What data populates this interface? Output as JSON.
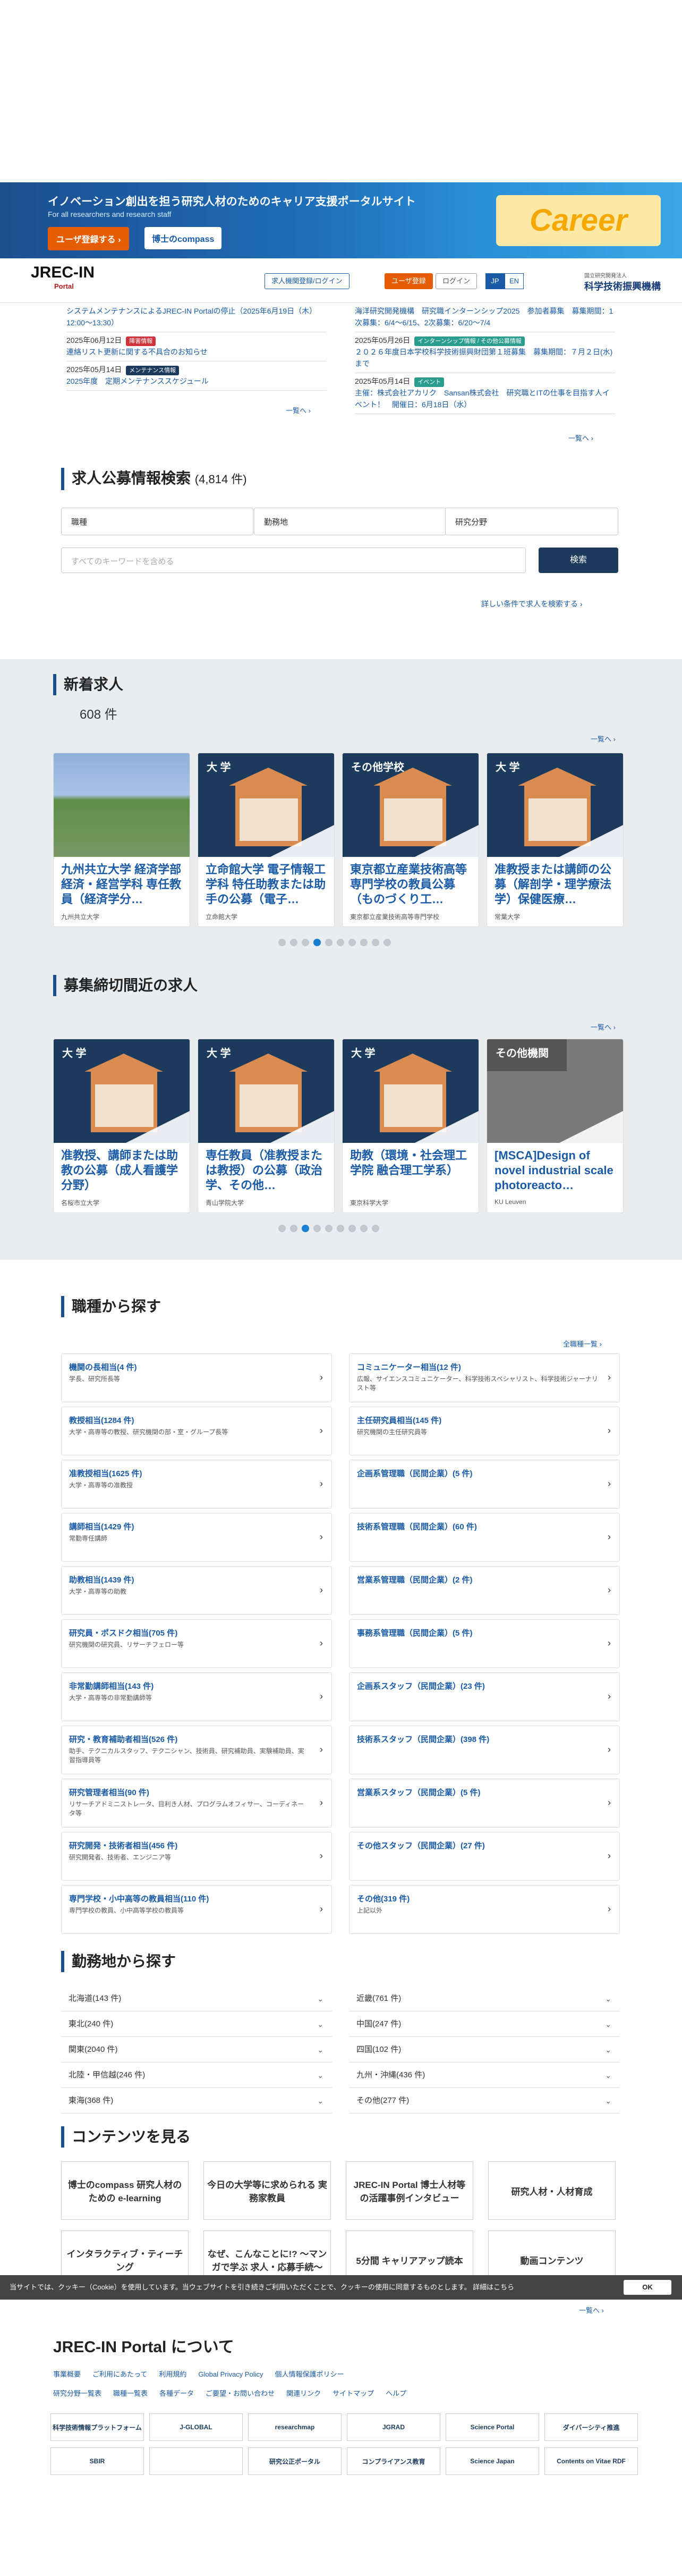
{
  "banner": {
    "title": "イノベーション創出を担う研究人材のためのキャリア支援ポータルサイト",
    "subtitle": "For all researchers and research staff",
    "register": "ユーザ登録する ›",
    "compass": "博士のcompass",
    "career": "Career"
  },
  "header": {
    "logo": "JREC-IN",
    "logo_sub": "Portal",
    "recruiter_btn": "求人機関登録/ログイン",
    "register_btn": "ユーザ登録",
    "login_btn": "ログイン",
    "lang_jp": "JP",
    "lang_en": "EN",
    "jst_name": "科学技術振興機構",
    "jst_sub": "国立研究開発法人"
  },
  "news_left": [
    {
      "date": "",
      "tag": "",
      "text": "システムメンテナンスによるJREC-IN Portalの停止（2025年6月19日（木）12:00〜13:30）"
    },
    {
      "date": "2025年06月12日",
      "tag": "障害情報",
      "text": "連絡リスト更新に関する不具合のお知らせ"
    },
    {
      "date": "2025年05月14日",
      "tag": "メンテナンス情報",
      "text": "2025年度　定期メンテナンススケジュール"
    }
  ],
  "news_right": [
    {
      "date": "",
      "tag": "",
      "text": "海洋研究開発機構　研究職インターンシップ2025　参加者募集　募集期間：1次募集：6/4〜6/15、2次募集：6/20〜7/4"
    },
    {
      "date": "2025年05月26日",
      "tag": "インターンシップ情報 / その他公募情報",
      "text": "２０２６年度日本学校科学技術振興財団第１班募集　募集期間：７月２日(水)まで"
    },
    {
      "date": "2025年05月14日",
      "tag": "イベント",
      "text": "主催：株式会社アカリク　Sansan株式会社　研究職とITの仕事を目指す人イベント！　開催日：6月18日（水）"
    }
  ],
  "more": "一覧へ",
  "search": {
    "title": "求人公募情報検索",
    "count": "(4,814 件)",
    "select1": "職種",
    "select2": "勤務地",
    "select3": "研究分野",
    "keyword_placeholder": "すべてのキーワードを含める",
    "button": "検索",
    "detail_link": "詳しい条件で求人を検索する"
  },
  "new_jobs": {
    "title": "新着求人",
    "count": "608 件",
    "cards": [
      {
        "label": "",
        "title": "九州共立大学 経済学部 経済・経営学科 専任教員（経済学分…",
        "org": "九州共立大学"
      },
      {
        "label": "大 学",
        "title": "立命館大学 電子情報工学科 特任助教または助手の公募（電子…",
        "org": "立命館大学"
      },
      {
        "label": "その他学校",
        "title": "東京都立産業技術高等専門学校の教員公募（ものづくり工…",
        "org": "東京都立産業技術高等専門学校"
      },
      {
        "label": "大 学",
        "title": "准教授または講師の公募（解剖学・理学療法学）保健医療…",
        "org": "常葉大学"
      }
    ]
  },
  "closing_jobs": {
    "title": "募集締切間近の求人",
    "cards": [
      {
        "label": "大 学",
        "title": "准教授、講師または助教の公募（成人看護学分野）",
        "org": "名桜市立大学"
      },
      {
        "label": "大 学",
        "title": "専任教員（准教授または教授）の公募（政治学、その他…",
        "org": "青山学院大学"
      },
      {
        "label": "大 学",
        "title": "助教（環境・社会理工学院 融合理工学系）",
        "org": "東京科学大学"
      },
      {
        "label": "その他機関",
        "title": "[MSCA]Design of novel industrial scale photoreacto…",
        "org": "KU Leuven"
      }
    ]
  },
  "job_types": {
    "title": "職種から探す",
    "all_link": "全職種一覧",
    "items": [
      {
        "t": "機関の長相当(4 件)",
        "s": "学長、研究所長等"
      },
      {
        "t": "コミュニケーター相当(12 件)",
        "s": "広報、サイエンスコミュニケーター、科学技術スペシャリスト、科学技術ジャーナリスト等"
      },
      {
        "t": "教授相当(1284 件)",
        "s": "大学・高専等の教授、研究機関の部・室・グループ長等"
      },
      {
        "t": "主任研究員相当(145 件)",
        "s": "研究機関の主任研究員等"
      },
      {
        "t": "准教授相当(1625 件)",
        "s": "大学・高専等の准教授"
      },
      {
        "t": "企画系管理職（民間企業）(5 件)",
        "s": ""
      },
      {
        "t": "講師相当(1429 件)",
        "s": "常勤専任講師"
      },
      {
        "t": "技術系管理職（民間企業）(60 件)",
        "s": ""
      },
      {
        "t": "助教相当(1439 件)",
        "s": "大学・高専等の助教"
      },
      {
        "t": "営業系管理職（民間企業）(2 件)",
        "s": ""
      },
      {
        "t": "研究員・ポスドク相当(705 件)",
        "s": "研究機関の研究員、リサーチフェロー等"
      },
      {
        "t": "事務系管理職（民間企業）(5 件)",
        "s": ""
      },
      {
        "t": "非常勤講師相当(143 件)",
        "s": "大学・高専等の非常勤講師等"
      },
      {
        "t": "企画系スタッフ（民間企業）(23 件)",
        "s": ""
      },
      {
        "t": "研究・教育補助者相当(526 件)",
        "s": "助手、テクニカルスタッフ、テクニシャン、技術員、研究補助員、実験補助員、実習指導員等"
      },
      {
        "t": "技術系スタッフ（民間企業）(398 件)",
        "s": ""
      },
      {
        "t": "研究管理者相当(90 件)",
        "s": "リサーチアドミニストレータ、目利き人材、プログラムオフィサー、コーディネータ等"
      },
      {
        "t": "営業系スタッフ（民間企業）(5 件)",
        "s": ""
      },
      {
        "t": "研究開発・技術者相当(456 件)",
        "s": "研究開発者、技術者、エンジニア等"
      },
      {
        "t": "その他スタッフ（民間企業）(27 件)",
        "s": ""
      },
      {
        "t": "専門学校・小中高等の教員相当(110 件)",
        "s": "専門学校の教員、小中高等学校の教員等"
      },
      {
        "t": "その他(319 件)",
        "s": "上記以外"
      }
    ]
  },
  "areas": {
    "title": "勤務地から探す",
    "items": [
      "北海道(143 件)",
      "近畿(761 件)",
      "東北(240 件)",
      "中国(247 件)",
      "関東(2040 件)",
      "四国(102 件)",
      "北陸・甲信越(246 件)",
      "九州・沖縄(436 件)",
      "東海(368 件)",
      "その他(277 件)"
    ]
  },
  "contents": {
    "title": "コンテンツを見る",
    "items": [
      "博士のcompass 研究人材のための e-learning",
      "今日の大学等に求められる 実務家教員",
      "JREC-IN Portal 博士人材等の活躍事例インタビュー",
      "研究人材・人材育成",
      "インタラクティブ・ティーチング",
      "なぜ、こんなことに!? 〜マンガで学ぶ 求人・応募手続〜",
      "5分間 キャリアアップ読本",
      "動画コンテンツ"
    ]
  },
  "cookie": {
    "text": "当サイトでは、クッキー（Cookie）を使用しています。当ウェブサイトを引き続きご利用いただくことで、クッキーの使用に同意するものとします。 詳細はこちら",
    "ok": "OK"
  },
  "about": {
    "title": "JREC-IN Portal について",
    "links1": [
      "事業概要",
      "ご利用にあたって",
      "利用規約",
      "Global Privacy Policy",
      "個人情報保護ポリシー"
    ],
    "links2": [
      "研究分野一覧表",
      "職種一覧表",
      "各種データ",
      "ご要望・お問い合わせ",
      "関連リンク",
      "サイトマップ",
      "ヘルプ"
    ]
  },
  "partners": [
    "科学技術情報プラットフォーム",
    "J-GLOBAL",
    "researchmap",
    "JGRAD",
    "Science Portal",
    "ダイバーシティ推進",
    "SBIR",
    "",
    "研究公正ポータル",
    "コンプライアンス教育",
    "Science Japan",
    "Contents on Vitae RDF"
  ]
}
